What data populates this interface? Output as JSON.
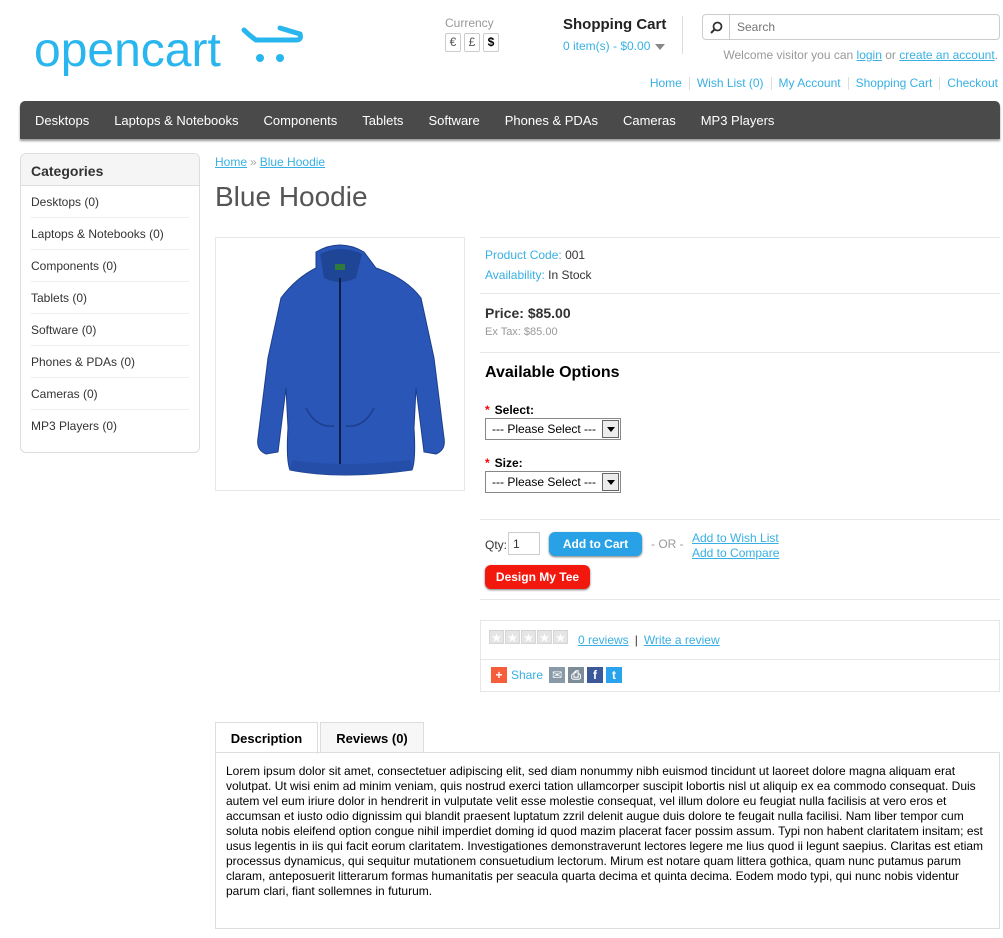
{
  "header": {
    "logo_text": "opencart",
    "currency": {
      "label": "Currency",
      "options": [
        "€",
        "£",
        "$"
      ],
      "active": "$"
    },
    "cart": {
      "title": "Shopping Cart",
      "summary": "0 item(s) - $0.00"
    },
    "search": {
      "placeholder": "Search"
    },
    "welcome": {
      "prefix": "Welcome visitor you can ",
      "login": "login",
      "or": " or ",
      "create": "create an account",
      "suffix": "."
    },
    "links": [
      "Home",
      "Wish List (0)",
      "My Account",
      "Shopping Cart",
      "Checkout"
    ]
  },
  "menu": [
    "Desktops",
    "Laptops & Notebooks",
    "Components",
    "Tablets",
    "Software",
    "Phones & PDAs",
    "Cameras",
    "MP3 Players"
  ],
  "sidebar": {
    "title": "Categories",
    "items": [
      "Desktops (0)",
      "Laptops & Notebooks (0)",
      "Components (0)",
      "Tablets (0)",
      "Software (0)",
      "Phones & PDAs (0)",
      "Cameras (0)",
      "MP3 Players (0)"
    ]
  },
  "breadcrumb": {
    "home": "Home",
    "separator": "»",
    "current": "Blue Hoodie"
  },
  "product": {
    "title": "Blue Hoodie",
    "code_label": "Product Code:",
    "code": "001",
    "availability_label": "Availability:",
    "availability": "In Stock",
    "price_label": "Price:",
    "price": "$85.00",
    "ex_tax": "Ex Tax: $85.00",
    "options_title": "Available Options",
    "option_select_label": "Select:",
    "option_size_label": "Size:",
    "please_select": "--- Please Select ---",
    "required_mark": "*",
    "qty_label": "Qty:",
    "qty_value": "1",
    "add_to_cart": "Add to Cart",
    "or_text": "- OR -",
    "wish_list": "Add to Wish List",
    "compare": "Add to Compare",
    "design": "Design My Tee",
    "reviews_count": "0 reviews",
    "review_separator": "|",
    "write_review": "Write a review",
    "share": "Share",
    "rating": 0
  },
  "tabs": [
    "Description",
    "Reviews (0)"
  ],
  "description": "Lorem ipsum dolor sit amet, consectetuer adipiscing elit, sed diam nonummy nibh euismod tincidunt ut laoreet dolore magna aliquam erat volutpat. Ut wisi enim ad minim veniam, quis nostrud exerci tation ullamcorper suscipit lobortis nisl ut aliquip ex ea commodo consequat. Duis autem vel eum iriure dolor in hendrerit in vulputate velit esse molestie consequat, vel illum dolore eu feugiat nulla facilisis at vero eros et accumsan et iusto odio dignissim qui blandit praesent luptatum zzril delenit augue duis dolore te feugait nulla facilisi. Nam liber tempor cum soluta nobis eleifend option congue nihil imperdiet doming id quod mazim placerat facer possim assum. Typi non habent claritatem insitam; est usus legentis in iis qui facit eorum claritatem. Investigationes demonstraverunt lectores legere me lius quod ii legunt saepius. Claritas est etiam processus dynamicus, qui sequitur mutationem consuetudium lectorum. Mirum est notare quam littera gothica, quam nunc putamus parum claram, anteposuerit litterarum formas humanitatis per seacula quarta decima et quinta decima. Eodem modo typi, qui nunc nobis videntur parum clari, fiant sollemnes in futurum.",
  "colors": {
    "accent": "#38b0e3",
    "menu_bg": "#4a4a4a",
    "cart_button": "#28a1e6",
    "design_button": "#f2180d",
    "hoodie": "#2a56b8"
  }
}
